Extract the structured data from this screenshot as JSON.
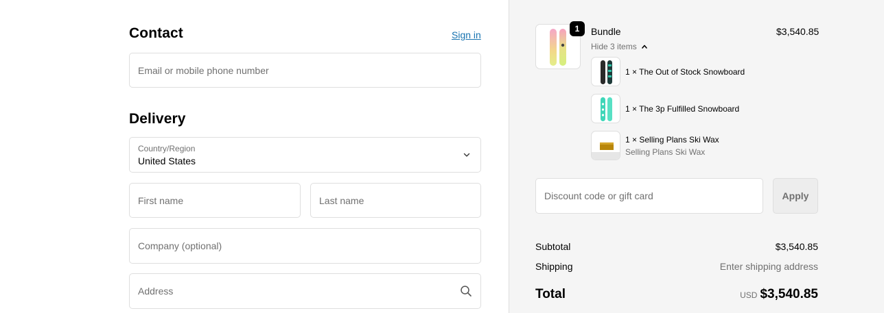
{
  "contact": {
    "title": "Contact",
    "sign_in": "Sign in",
    "email_placeholder": "Email or mobile phone number"
  },
  "delivery": {
    "title": "Delivery",
    "country_label": "Country/Region",
    "country_value": "United States",
    "first_name_placeholder": "First name",
    "last_name_placeholder": "Last name",
    "company_placeholder": "Company (optional)",
    "address_placeholder": "Address"
  },
  "summary": {
    "bundle": {
      "name": "Bundle",
      "price": "$3,540.85",
      "quantity": "1",
      "toggle": "Hide 3 items",
      "items": [
        {
          "label": "1 × The Out of Stock Snowboard"
        },
        {
          "label": "1 × The 3p Fulfilled Snowboard"
        },
        {
          "label": "1 × Selling Plans Ski Wax",
          "detail": "Selling Plans Ski Wax"
        }
      ]
    },
    "discount_placeholder": "Discount code or gift card",
    "apply": "Apply",
    "subtotal_label": "Subtotal",
    "subtotal_value": "$3,540.85",
    "shipping_label": "Shipping",
    "shipping_value": "Enter shipping address",
    "total_label": "Total",
    "total_currency": "USD",
    "total_value": "$3,540.85"
  },
  "colors": {
    "link": "#1773b0",
    "panel_bg": "#f5f5f5",
    "border": "#dedede"
  },
  "icons": [
    "chevron-down-icon",
    "search-icon",
    "chevron-up-icon"
  ]
}
